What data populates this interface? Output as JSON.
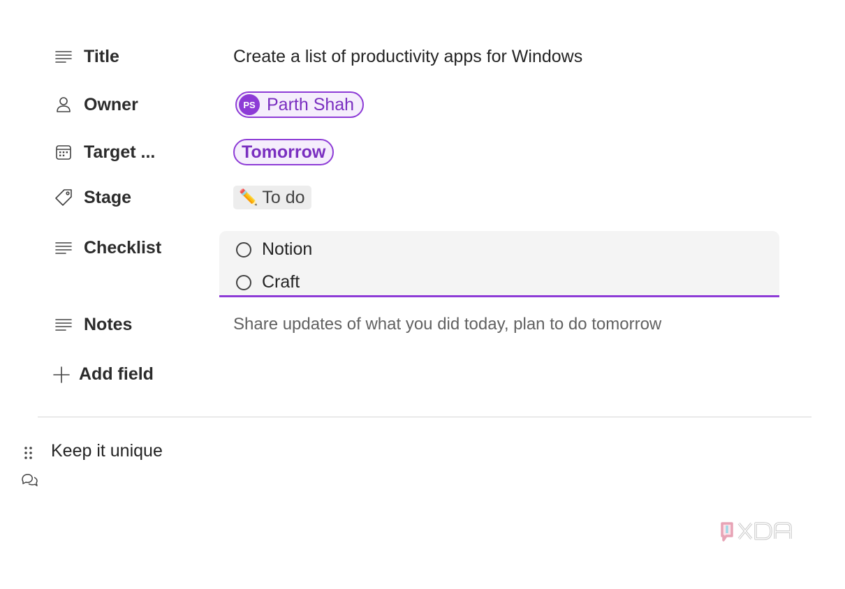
{
  "fields": {
    "title": {
      "label": "Title",
      "value": "Create a list of productivity apps for Windows",
      "icon": "text-lines-icon"
    },
    "owner": {
      "label": "Owner",
      "initials": "PS",
      "name": "Parth Shah",
      "icon": "person-icon"
    },
    "target_date": {
      "label": "Target ...",
      "value": "Tomorrow",
      "icon": "calendar-icon"
    },
    "stage": {
      "label": "Stage",
      "emoji": "✏️",
      "value": "To do",
      "icon": "tag-icon"
    },
    "checklist": {
      "label": "Checklist",
      "icon": "text-lines-icon",
      "items": [
        {
          "text": "Notion",
          "checked": false
        },
        {
          "text": "Craft",
          "checked": false
        }
      ]
    },
    "notes": {
      "label": "Notes",
      "placeholder": "Share updates of what you did today, plan to do tomorrow",
      "icon": "text-lines-icon"
    }
  },
  "add_field": {
    "label": "Add field",
    "icon": "plus-icon"
  },
  "block": {
    "text": "Keep it unique",
    "handle_icon": "drag-handle-icon",
    "comment_icon": "comment-icon"
  },
  "colors": {
    "accent": "#8d3bd6",
    "accent_text": "#7a2fc0",
    "pill_bg": "#f5eefc",
    "chip_bg": "#ededed",
    "checklist_bg": "#f4f4f4",
    "divider": "#d6d6d6"
  },
  "watermark": {
    "brand": "XDA",
    "icon": "xda-logo-icon"
  }
}
